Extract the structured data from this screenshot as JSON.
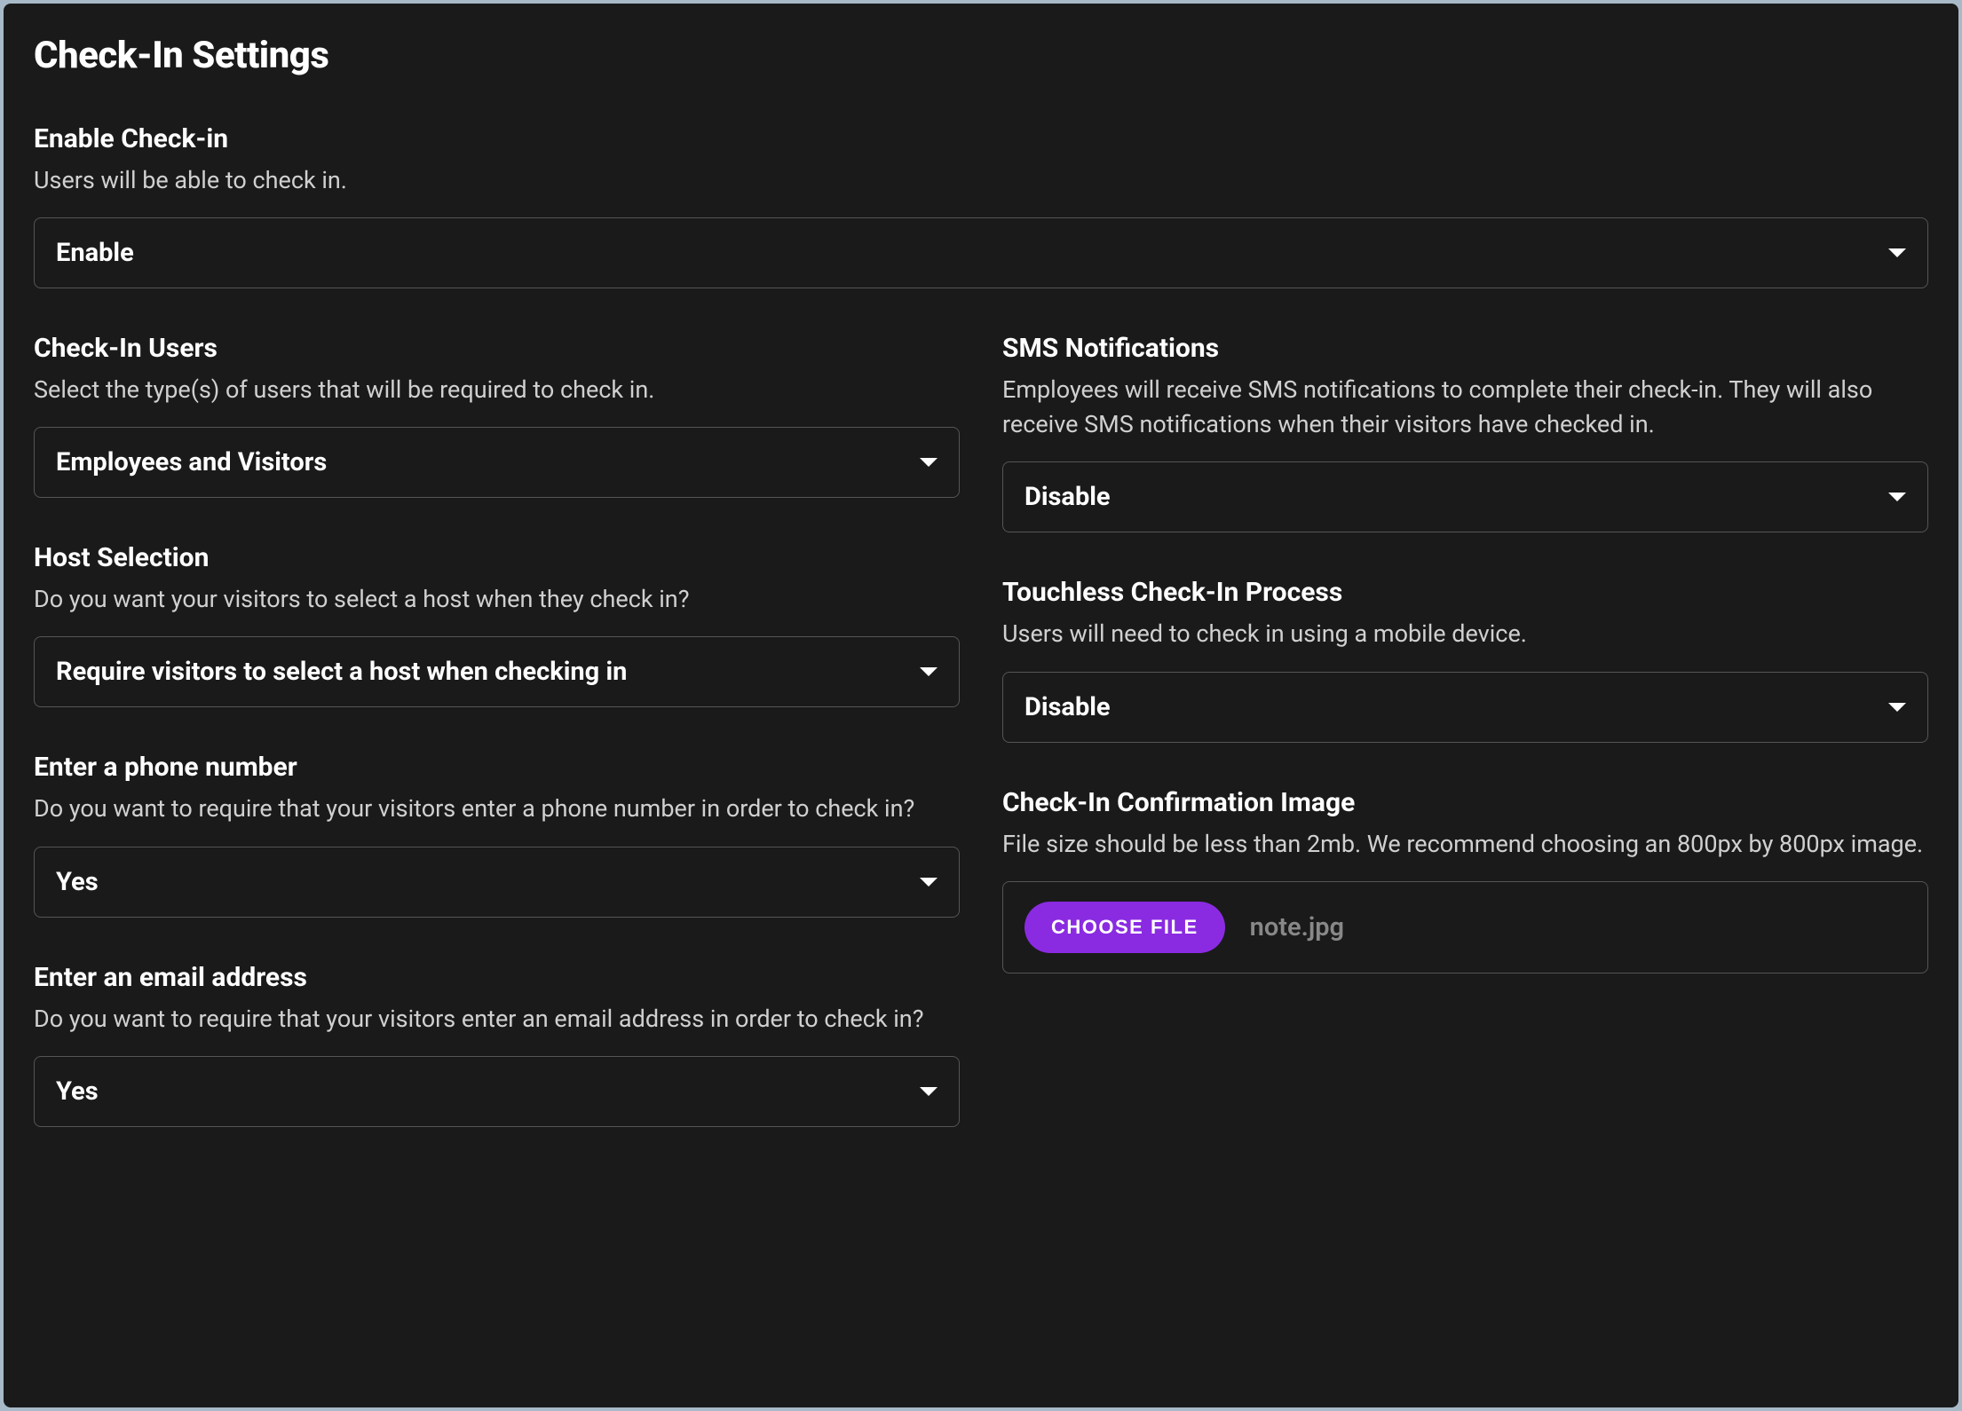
{
  "page_title": "Check-In Settings",
  "enable_checkin": {
    "label": "Enable Check-in",
    "description": "Users will be able to check in.",
    "value": "Enable"
  },
  "left_column": {
    "checkin_users": {
      "label": "Check-In Users",
      "description": "Select the type(s) of users that will be required to check in.",
      "value": "Employees and Visitors"
    },
    "host_selection": {
      "label": "Host Selection",
      "description": "Do you want your visitors to select a host when they check in?",
      "value": "Require visitors to select a host when checking in"
    },
    "phone_number": {
      "label": "Enter a phone number",
      "description": "Do you want to require that your visitors enter a phone number in order to check in?",
      "value": "Yes"
    },
    "email_address": {
      "label": "Enter an email address",
      "description": "Do you want to require that your visitors enter an email address in order to check in?",
      "value": "Yes"
    }
  },
  "right_column": {
    "sms_notifications": {
      "label": "SMS Notifications",
      "description": "Employees will receive SMS notifications to complete their check-in. They will also receive SMS notifications when their visitors have checked in.",
      "value": "Disable"
    },
    "touchless": {
      "label": "Touchless Check-In Process",
      "description": "Users will need to check in using a mobile device.",
      "value": "Disable"
    },
    "confirmation_image": {
      "label": "Check-In Confirmation Image",
      "description": "File size should be less than 2mb. We recommend choosing an 800px by 800px image.",
      "button_label": "CHOOSE FILE",
      "file_name": "note.jpg"
    }
  }
}
